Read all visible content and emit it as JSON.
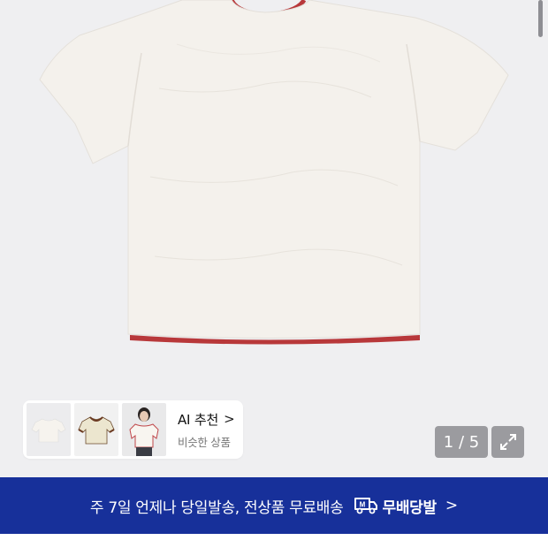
{
  "product_image": {
    "alt": "",
    "current_page": "1",
    "total_pages": "5",
    "counter_text": "1 / 5"
  },
  "ai_recommend": {
    "title": "AI 추천",
    "subtitle": "비슷한 상품",
    "chevron": ">",
    "thumbnails": [
      "thumb-white-tshirt",
      "thumb-ringer-tshirt",
      "thumb-model-photo"
    ]
  },
  "expand_icon": "expand-icon",
  "banner": {
    "text": "주 7일 언제나 당일발송, 전상품 무료배송",
    "badge_text": "무배당발",
    "badge_icon": "truck-m-icon",
    "chevron": ">"
  },
  "colors": {
    "background": "#efeff1",
    "banner": "#17309a",
    "counter_bg": "#9b9b9f",
    "trim_red": "#b8383a",
    "shirt": "#f4f1ec"
  }
}
